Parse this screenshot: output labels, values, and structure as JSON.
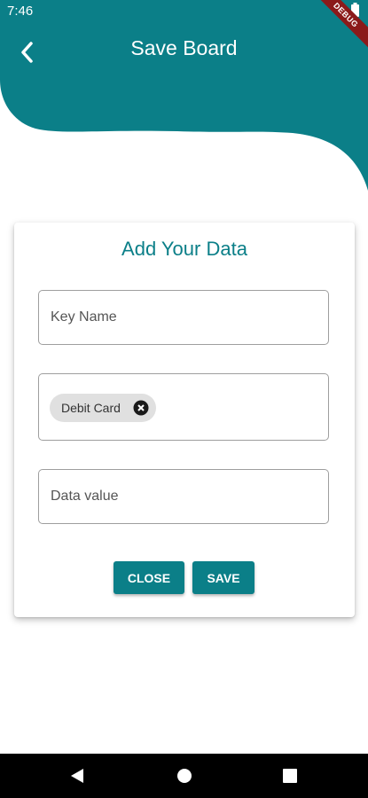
{
  "status_bar": {
    "time": "7:46",
    "debug_label": "DEBUG"
  },
  "app_bar": {
    "title": "Save Board"
  },
  "form": {
    "title": "Add Your Data",
    "key_name": {
      "placeholder": "Key Name",
      "value": ""
    },
    "category_chip": {
      "label": "Debit Card"
    },
    "data_value": {
      "placeholder": "Data value",
      "value": ""
    },
    "close_label": "CLOSE",
    "save_label": "SAVE"
  },
  "colors": {
    "primary": "#0b7f88"
  },
  "icons": {
    "back": "chevron-left-icon",
    "chip_remove": "cancel-circle-icon",
    "nav_back": "triangle-back-icon",
    "nav_home": "circle-home-icon",
    "nav_recents": "square-recents-icon"
  }
}
